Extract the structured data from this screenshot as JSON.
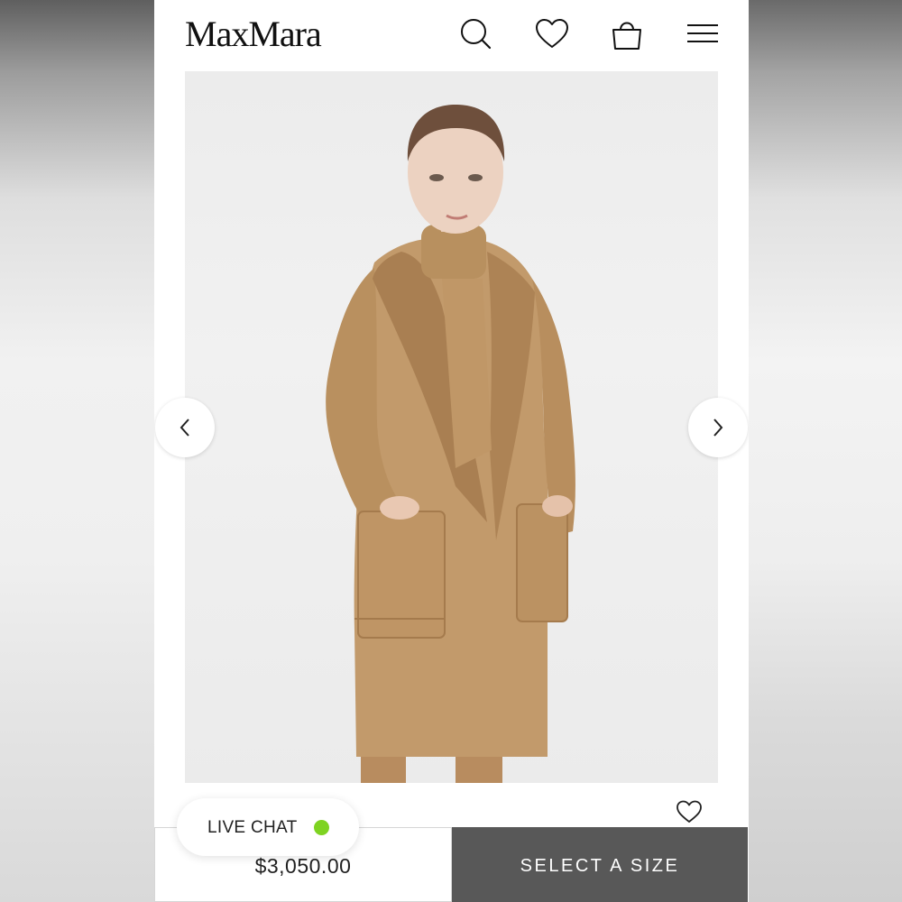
{
  "header": {
    "logo": "MaxMara",
    "icons": [
      "search-icon",
      "heart-icon",
      "shopping-bag-icon",
      "menu-icon"
    ]
  },
  "gallery": {
    "prev_icon": "chevron-left-icon",
    "next_icon": "chevron-right-icon"
  },
  "wishlist_icon": "heart-outline-icon",
  "live_chat": {
    "label": "LIVE CHAT",
    "status_color": "#7ed321"
  },
  "purchase": {
    "price": "$3,050.00",
    "select_size_label": "SELECT A SIZE"
  },
  "colors": {
    "button_bg": "#585858",
    "coat": "#c29a6b",
    "background": "#ffffff"
  }
}
